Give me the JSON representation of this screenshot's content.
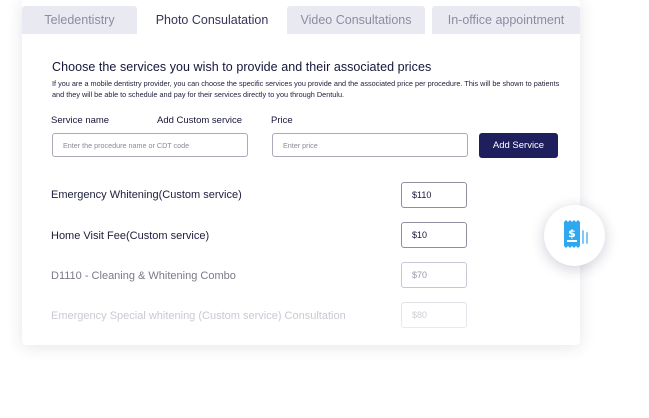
{
  "tabs": [
    {
      "label": "Teledentistry"
    },
    {
      "label": "Photo Consulatation"
    },
    {
      "label": "Video Consultations"
    },
    {
      "label": "In-office appointment"
    }
  ],
  "active_tab": "Photo Consulatation",
  "section": {
    "heading": "Choose the services you wish to provide and their associated prices",
    "description": "If you are a mobile dentistry provider, you can choose the specific services you provide and the associated price per procedure. This will be shown to patients and they will be able to schedule and pay for their services directly to you through Dentulu."
  },
  "form": {
    "service_label": "Service name",
    "custom_label": "Add Custom service",
    "price_label": "Price",
    "service_placeholder": "Enter the procedure name  or CDT code",
    "price_placeholder": "Enter price",
    "add_button": "Add Service"
  },
  "services": [
    {
      "name": "Emergency Whitening(Custom service)",
      "price": "$110"
    },
    {
      "name": "Home Visit Fee(Custom service)",
      "price": "$10"
    },
    {
      "name": "D1110 - Cleaning & Whitening Combo",
      "price": "$70"
    },
    {
      "name": "Emergency Special whitening (Custom service) Consultation",
      "price": "$80"
    }
  ],
  "colors": {
    "primary": "#1f1f5e",
    "accent_icon": "#2ea8ef",
    "tab_inactive_bg": "#e9e9f1"
  },
  "floating_icon": "receipt-dollar-icon"
}
